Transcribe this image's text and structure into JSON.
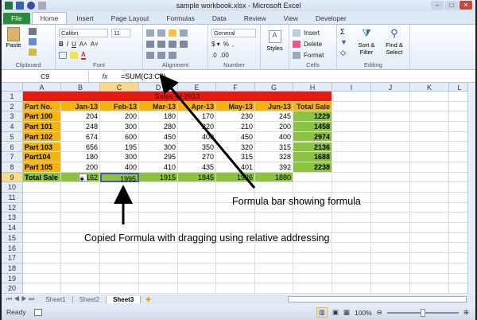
{
  "window": {
    "title": "sample workbook.xlsx - Microsoft Excel"
  },
  "tabs": [
    "File",
    "Home",
    "Insert",
    "Page Layout",
    "Formulas",
    "Data",
    "Review",
    "View",
    "Developer"
  ],
  "ribbon": {
    "clipboard": {
      "label": "Clipboard",
      "paste": "Paste"
    },
    "font": {
      "label": "Font",
      "name": "Calibri",
      "size": "11"
    },
    "alignment": {
      "label": "Alignment"
    },
    "number": {
      "label": "Number",
      "format": "General"
    },
    "styles": {
      "label": "Styles"
    },
    "cells": {
      "label": "Cells",
      "insert": "Insert",
      "delete": "Delete",
      "format": "Format"
    },
    "editing": {
      "label": "Editing",
      "sort": "Sort & Filter",
      "find": "Find & Select"
    }
  },
  "formula_bar": {
    "name_box": "C9",
    "fx": "fx",
    "formula": "=SUM(C3:C8)"
  },
  "columns": [
    "A",
    "B",
    "C",
    "D",
    "E",
    "F",
    "G",
    "H",
    "I",
    "J",
    "K",
    "L"
  ],
  "selected_cell": "C9",
  "sheet": {
    "title": "Sales of 2013",
    "header": [
      "Part No.",
      "Jan-13",
      "Feb-13",
      "Mar-13",
      "Apr-13",
      "May-13",
      "Jun-13",
      "Total Sale"
    ],
    "rows": [
      [
        "Part 100",
        "204",
        "200",
        "180",
        "170",
        "230",
        "245",
        "1229"
      ],
      [
        "Part 101",
        "248",
        "300",
        "280",
        "220",
        "210",
        "200",
        "1458"
      ],
      [
        "Part 102",
        "674",
        "600",
        "450",
        "400",
        "450",
        "400",
        "2974"
      ],
      [
        "Part 103",
        "656",
        "195",
        "300",
        "350",
        "320",
        "315",
        "2136"
      ],
      [
        "Part104",
        "180",
        "300",
        "295",
        "270",
        "315",
        "328",
        "1688"
      ],
      [
        "Part 105",
        "200",
        "400",
        "410",
        "435",
        "401",
        "392",
        "2238"
      ]
    ],
    "total": [
      "Total Sale",
      "2162",
      "1995",
      "1915",
      "1845",
      "1926",
      "1880",
      ""
    ]
  },
  "colors": {
    "title_fill": "#e8190f",
    "header_fill": "#f6b30a",
    "total_fill": "#8cc43f",
    "selection": "#4a5aa8"
  },
  "sheet_tabs": [
    "Sheet1",
    "Sheet2",
    "Sheet3"
  ],
  "active_sheet": "Sheet3",
  "status": {
    "ready": "Ready",
    "zoom": "100%"
  },
  "annotations": {
    "formula_bar": "Formula bar showing formula",
    "copied": "Copied Formula with dragging using relative addressing"
  }
}
